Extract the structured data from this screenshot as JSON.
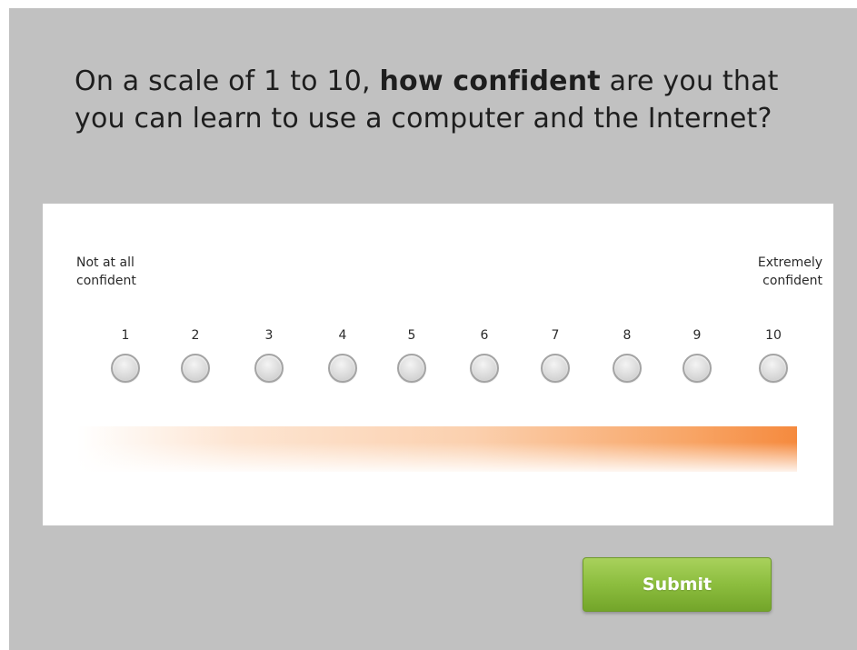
{
  "question": {
    "part1": "On a scale of 1 to 10, ",
    "emphasis": "how confident",
    "part2": " are you that you can learn to use a computer and the Internet?"
  },
  "scale": {
    "left_anchor": {
      "line1": "Not at all",
      "line2": "confident"
    },
    "right_anchor": {
      "line1": "Extremely",
      "line2": "confident"
    },
    "options": [
      "1",
      "2",
      "3",
      "4",
      "5",
      "6",
      "7",
      "8",
      "9",
      "10"
    ],
    "selected": null
  },
  "submit": {
    "label": "Submit"
  },
  "colors": {
    "background": "#c1c1c1",
    "panel": "#ffffff",
    "accent_orange": "#f58a3e",
    "button_green": "#8cbd3e"
  }
}
